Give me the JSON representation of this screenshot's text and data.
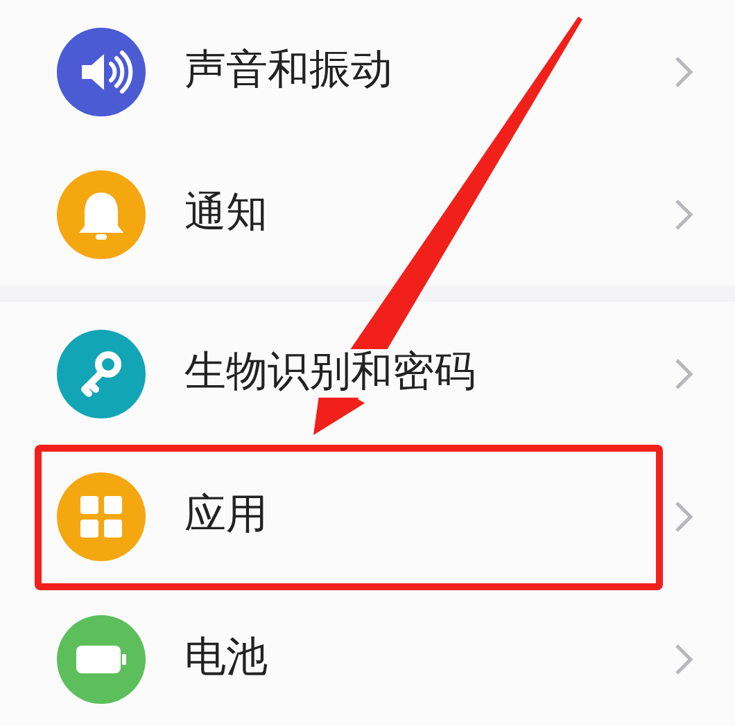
{
  "groups": [
    {
      "items": [
        {
          "kind": "sound",
          "label": "声音和振动",
          "color": "#4a5bd4",
          "highlighted": false
        },
        {
          "kind": "bell",
          "label": "通知",
          "color": "#f5a70f",
          "highlighted": false
        }
      ]
    },
    {
      "items": [
        {
          "kind": "key",
          "label": "生物识别和密码",
          "color": "#12a5b5",
          "highlighted": false
        },
        {
          "kind": "grid",
          "label": "应用",
          "color": "#f5a70f",
          "highlighted": true
        },
        {
          "kind": "battery",
          "label": "电池",
          "color": "#5cbf5c",
          "highlighted": false
        }
      ]
    }
  ]
}
